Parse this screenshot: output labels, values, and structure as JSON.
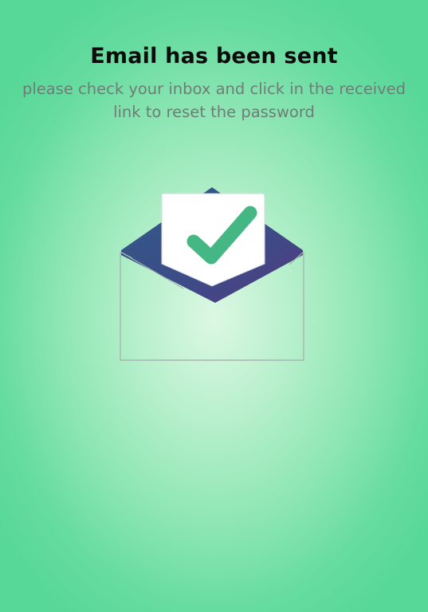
{
  "confirmation": {
    "title": "Email has been sent",
    "message": "please check your inbox and click in the received link to reset the password"
  },
  "illustration": {
    "name": "envelope-with-checkmark",
    "colors": {
      "envelope_inner": "#3b4f8a",
      "envelope_inner_dark": "#4a3c80",
      "card": "#ffffff",
      "check": "#45b886",
      "envelope_outline": "#a3b0ad"
    }
  },
  "background": {
    "center": "#dcf8e3",
    "edge": "#58d898"
  }
}
